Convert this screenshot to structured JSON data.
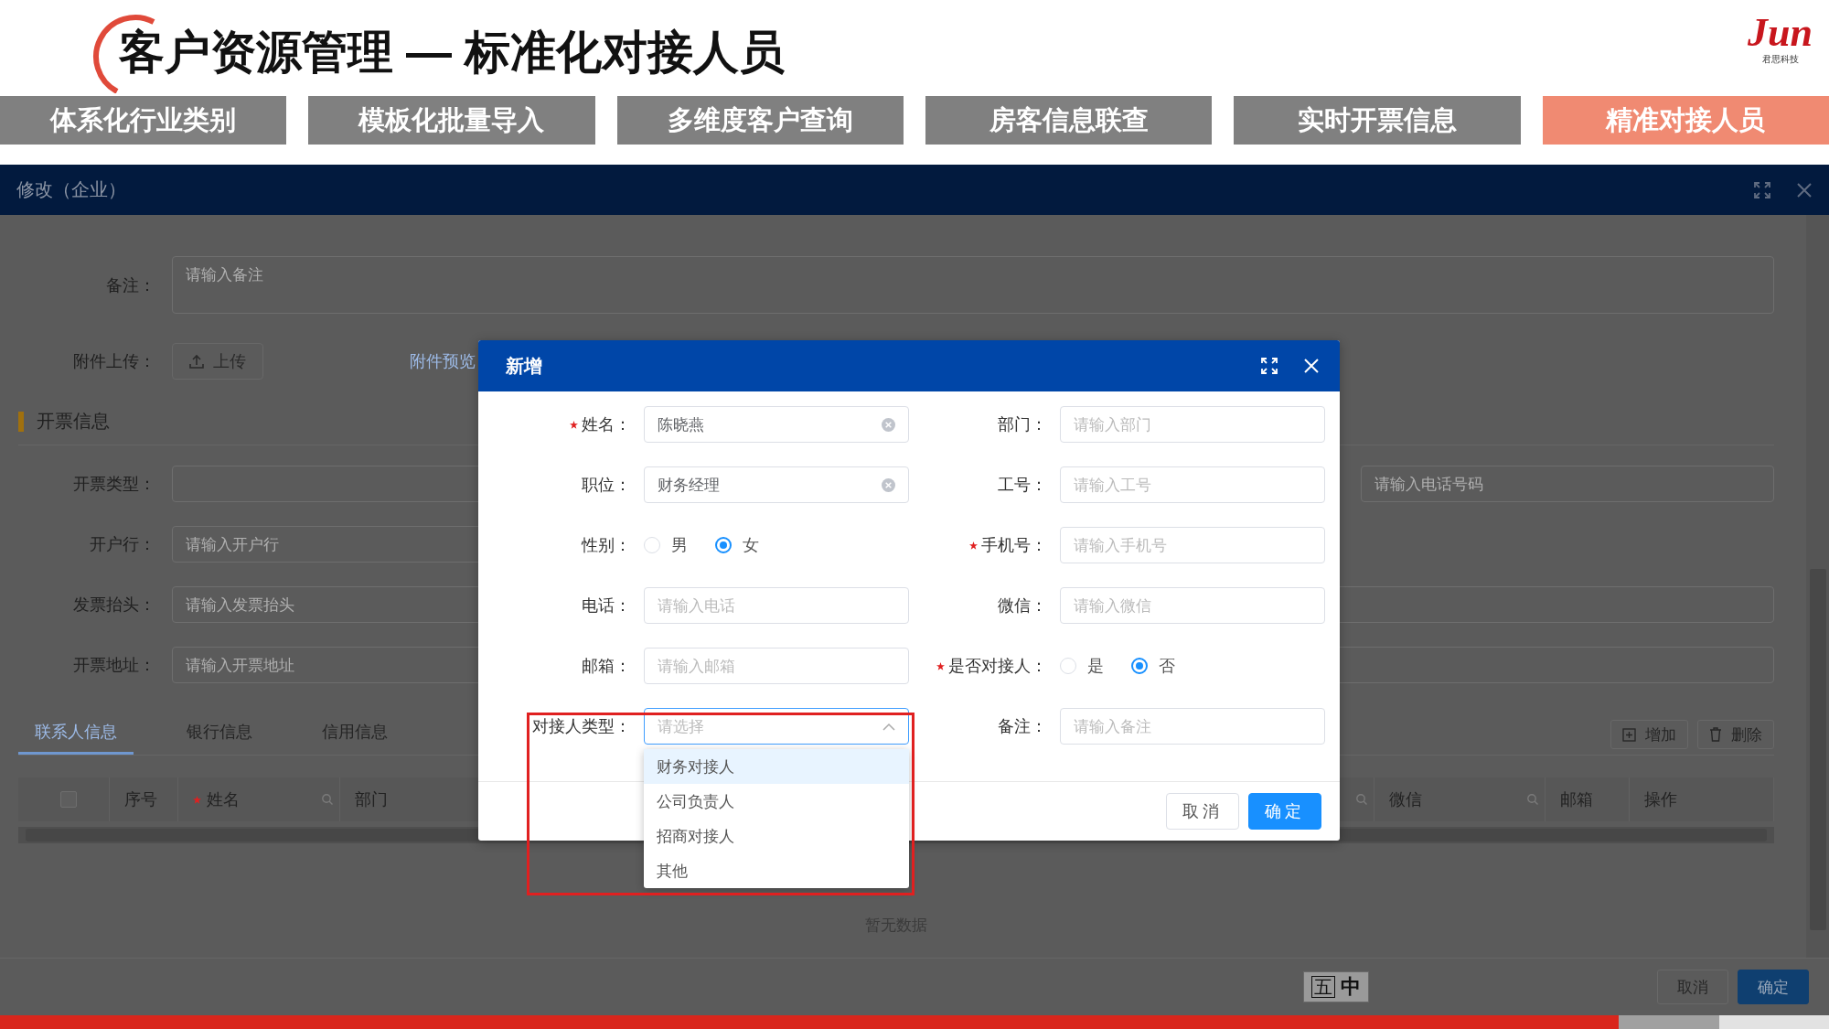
{
  "slide": {
    "title": "客户资源管理 — 标准化对接人员",
    "logo": "Jun",
    "logo_subtitle": "君思科技"
  },
  "feature_tabs": [
    {
      "label": "体系化行业类别",
      "selected": false
    },
    {
      "label": "模板化批量导入",
      "selected": false
    },
    {
      "label": "多维度客户查询",
      "selected": false
    },
    {
      "label": "房客信息联查",
      "selected": false
    },
    {
      "label": "实时开票信息",
      "selected": false
    },
    {
      "label": "精准对接人员",
      "selected": true
    }
  ],
  "window": {
    "title": "修改（企业）",
    "remark": {
      "label": "备注：",
      "placeholder": "请输入备注"
    },
    "attachment": {
      "label": "附件上传：",
      "button": "上传",
      "link": "附件预览"
    },
    "section": "开票信息",
    "invoice_rows": [
      {
        "label": "开票类型：",
        "field_2_placeholder": "请输入电话号码"
      },
      {
        "label": "开户行：",
        "placeholder": "请输入开户行"
      },
      {
        "label": "发票抬头：",
        "placeholder": "请输入发票抬头",
        "wide": true
      },
      {
        "label": "开票地址：",
        "placeholder": "请输入开票地址",
        "wide": true
      }
    ],
    "detail_tabs": [
      {
        "label": "联系人信息",
        "selected": true
      },
      {
        "label": "银行信息",
        "selected": false
      },
      {
        "label": "信用信息",
        "selected": false
      }
    ],
    "table_actions": [
      {
        "kind": "add",
        "label": "增加"
      },
      {
        "kind": "delete",
        "label": "删除"
      }
    ],
    "table": {
      "columns": [
        {
          "kind": "checkbox",
          "checked": false
        },
        {
          "label": "序号"
        },
        {
          "label": "姓名",
          "required": true,
          "filterable": true
        },
        {
          "label": "部门"
        },
        {
          "kind": "hidden",
          "filterable": true
        },
        {
          "label": "微信",
          "filterable": true
        },
        {
          "label": "邮箱"
        },
        {
          "label": "操作"
        }
      ],
      "empty_text": "暂无数据"
    },
    "ime": [
      "五",
      "中"
    ],
    "buttons": [
      "取消",
      "确定"
    ]
  },
  "dialog": {
    "title": "新增",
    "fields": [
      {
        "kind": "input",
        "label": "姓名：",
        "required": true,
        "value": "陈晓燕",
        "clearable": true
      },
      {
        "kind": "input",
        "label": "部门：",
        "placeholder": "请输入部门"
      },
      {
        "kind": "input",
        "label": "职位：",
        "value": "财务经理",
        "clearable": true
      },
      {
        "kind": "input",
        "label": "工号：",
        "placeholder": "请输入工号"
      },
      {
        "kind": "radio",
        "label": "性别：",
        "options": [
          {
            "label": "男",
            "selected": false
          },
          {
            "label": "女",
            "selected": true
          }
        ]
      },
      {
        "kind": "input",
        "label": "手机号：",
        "required": true,
        "placeholder": "请输入手机号"
      },
      {
        "kind": "input",
        "label": "电话：",
        "placeholder": "请输入电话"
      },
      {
        "kind": "input",
        "label": "微信：",
        "placeholder": "请输入微信"
      },
      {
        "kind": "input",
        "label": "邮箱：",
        "placeholder": "请输入邮箱"
      },
      {
        "kind": "radio",
        "label": "是否对接人：",
        "required": true,
        "options": [
          {
            "label": "是",
            "selected": false
          },
          {
            "label": "否",
            "selected": true
          }
        ]
      },
      {
        "kind": "select",
        "label": "对接人类型：",
        "placeholder": "请选择",
        "expanded": true,
        "highlighted": true
      },
      {
        "kind": "input",
        "label": "备注：",
        "placeholder": "请输入备注"
      }
    ],
    "dropdown": [
      {
        "label": "财务对接人",
        "highlighted": true
      },
      {
        "label": "公司负责人",
        "highlighted": false
      },
      {
        "label": "招商对接人",
        "highlighted": false
      },
      {
        "label": "其他",
        "highlighted": false
      }
    ],
    "buttons": [
      {
        "label": "取消",
        "primary": false
      },
      {
        "label": "确定",
        "primary": true
      }
    ]
  }
}
